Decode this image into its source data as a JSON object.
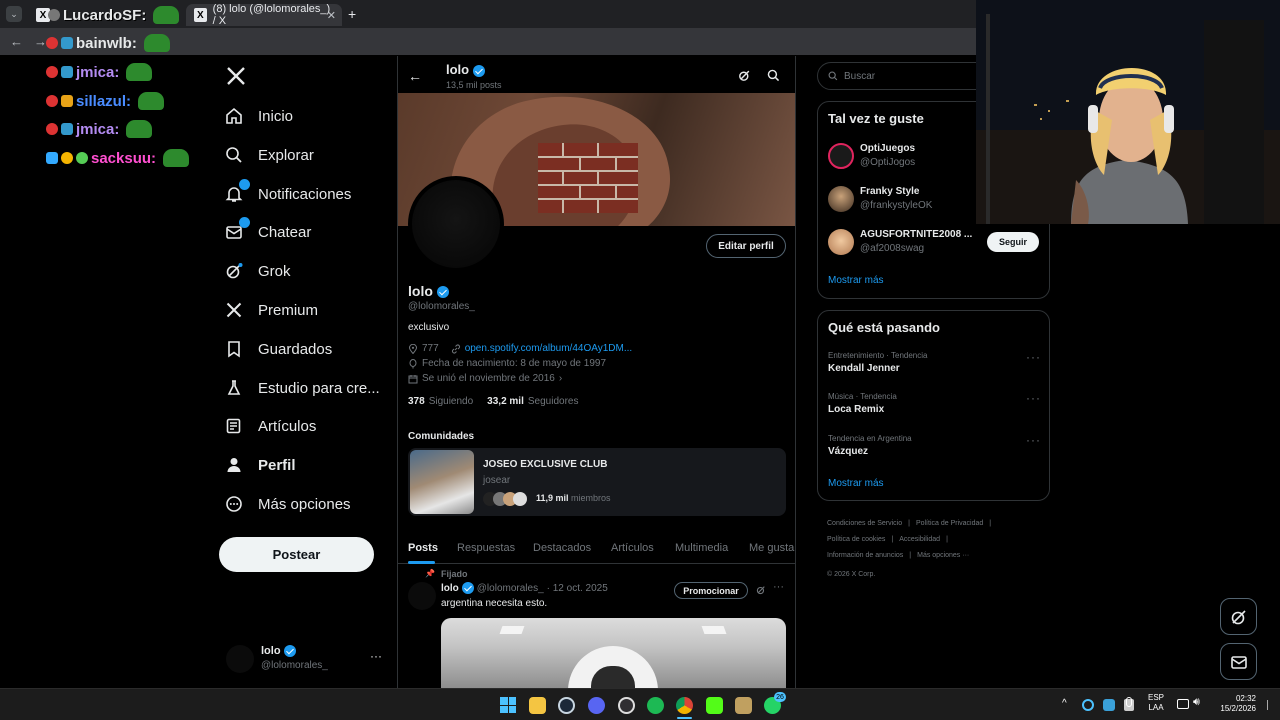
{
  "browser": {
    "tabs": [
      {
        "title": "LucardoSF"
      },
      {
        "title": "(8) lolo (@lolomorales_) / X"
      }
    ],
    "new_tab_icon": "plus-icon"
  },
  "chat_overlay": [
    {
      "user": "LucardoSF:",
      "color": "#e7e9ea"
    },
    {
      "user": "bainwlb:",
      "color": "#e7e9ea"
    },
    {
      "user": "jmica:",
      "color": "#b48cf2"
    },
    {
      "user": "sillazul:",
      "color": "#4a8cff"
    },
    {
      "user": "jmica:",
      "color": "#b48cf2"
    },
    {
      "user": "sacksuu:",
      "color": "#ff4fd0"
    }
  ],
  "nav": {
    "logo": "x-logo-icon",
    "items": [
      {
        "label": "Inicio",
        "icon": "home-icon"
      },
      {
        "label": "Explorar",
        "icon": "search-icon"
      },
      {
        "label": "Notificaciones",
        "icon": "bell-icon",
        "badge": ""
      },
      {
        "label": "Chatear",
        "icon": "mail-icon",
        "badge": ""
      },
      {
        "label": "Grok",
        "icon": "grok-icon"
      },
      {
        "label": "Premium",
        "icon": "x-premium-icon"
      },
      {
        "label": "Guardados",
        "icon": "bookmark-icon"
      },
      {
        "label": "Estudio para cre...",
        "icon": "flask-icon"
      },
      {
        "label": "Artículos",
        "icon": "article-icon"
      },
      {
        "label": "Perfil",
        "icon": "person-icon"
      },
      {
        "label": "Más opciones",
        "icon": "more-circle-icon"
      }
    ],
    "post_button": "Postear",
    "account": {
      "name": "lolo",
      "handle": "@lolomorales_"
    }
  },
  "profile": {
    "header_name": "lolo",
    "post_count": "13,5 mil posts",
    "name": "lolo",
    "handle": "@lolomorales_",
    "edit_button": "Editar perfil",
    "bio": "exclusivo",
    "location": "777",
    "link": "open.spotify.com/album/44OAy1DM...",
    "birthday": "Fecha de nacimiento: 8 de mayo de 1997",
    "joined": "Se unió el noviembre de 2016",
    "following_count": "378",
    "following_label": "Siguiendo",
    "followers_count": "33,2 mil",
    "followers_label": "Seguidores",
    "communities_title": "Comunidades",
    "community": {
      "name": "JOSEO EXCLUSIVE CLUB",
      "subtitle": "josear",
      "members_count": "11,9 mil",
      "members_label": "miembros"
    },
    "tabs": [
      "Posts",
      "Respuestas",
      "Destacados",
      "Artículos",
      "Multimedia",
      "Me gusta"
    ],
    "pinned_label": "Fijado",
    "post": {
      "name": "lolo",
      "handle": "@lolomorales_",
      "date": "· 12 oct. 2025",
      "text": "argentina necesita esto.",
      "promote_button": "Promocionar"
    }
  },
  "right": {
    "search_placeholder": "Buscar",
    "suggest_title": "Tal vez te guste",
    "suggestions": [
      {
        "name": "OptiJuegos",
        "handle": "@OptiJogos"
      },
      {
        "name": "Franky Style",
        "handle": "@frankystyleOK"
      },
      {
        "name": "AGUSFORTNITE2008 ...",
        "handle": "@af2008swag",
        "button": "Seguir"
      }
    ],
    "show_more_1": "Mostrar más",
    "trends_title": "Qué está pasando",
    "trends": [
      {
        "category": "Entretenimiento · Tendencia",
        "name": "Kendall Jenner"
      },
      {
        "category": "Música · Tendencia",
        "name": "Loca Remix"
      },
      {
        "category": "Tendencia en Argentina",
        "name": "Vázquez"
      }
    ],
    "show_more_2": "Mostrar más",
    "footer": [
      "Condiciones de Servicio",
      "|",
      "Política de Privacidad",
      "|",
      "Política de cookies",
      "|",
      "Accesibilidad",
      "|",
      "Información de anuncios",
      "|",
      "Más opciones ···",
      "© 2026 X Corp."
    ]
  },
  "taskbar": {
    "lang": "ESP",
    "lang2": "LAA",
    "time": "02:32",
    "date": "15/2/2026",
    "whatsapp_badge": "26"
  }
}
